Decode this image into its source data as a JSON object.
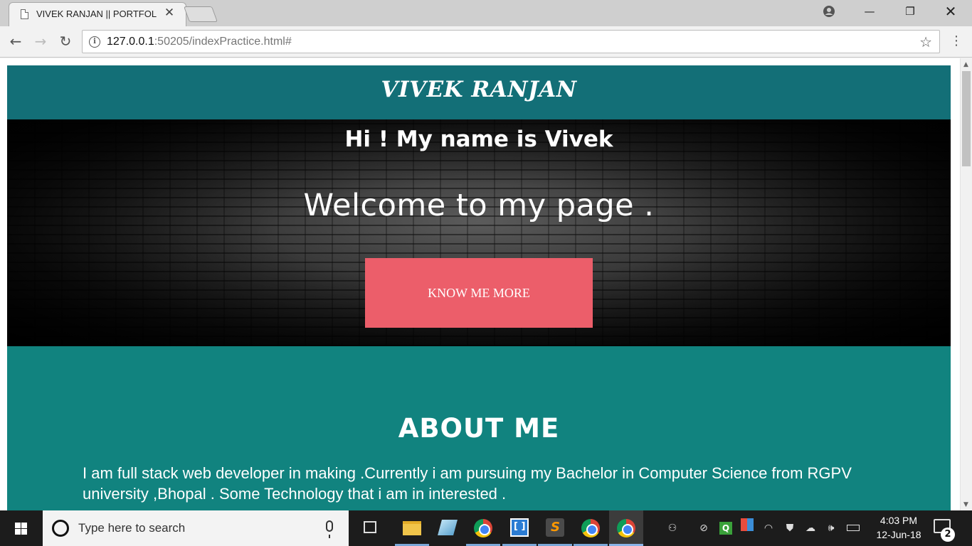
{
  "browser": {
    "tab_title": "VIVEK RANJAN || PORTFOLIO",
    "tab_close": "✕",
    "window_controls": {
      "minimize": "—",
      "maximize": "❐",
      "close": "✕"
    },
    "nav": {
      "back": "←",
      "forward": "→",
      "reload": "↻"
    },
    "url_host": "127.0.0.1",
    "url_rest": ":50205/indexPractice.html#",
    "star": "☆",
    "menu": "⋮"
  },
  "page": {
    "site_title": "VIVEK RANJAN",
    "hero": {
      "greeting": "Hi ! My name is Vivek",
      "welcome": "Welcome to my page .",
      "button_label": "KNOW ME MORE"
    },
    "about": {
      "heading": "ABOUT ME",
      "text": "I am full stack web developer in making .Currently i am pursuing my Bachelor in Computer Science from RGPV university ,Bhopal . Some Technology that i am in interested ."
    }
  },
  "taskbar": {
    "search_placeholder": "Type here to search",
    "apps": [
      "task-view",
      "file-explorer",
      "notes",
      "chrome",
      "brackets",
      "sublime-text",
      "chrome",
      "chrome"
    ],
    "time": "4:03 PM",
    "date": "12-Jun-18",
    "notification_count": "2"
  },
  "colors": {
    "header_bg": "#136f77",
    "about_bg": "#11837f",
    "button_bg": "#ec5e6a"
  }
}
